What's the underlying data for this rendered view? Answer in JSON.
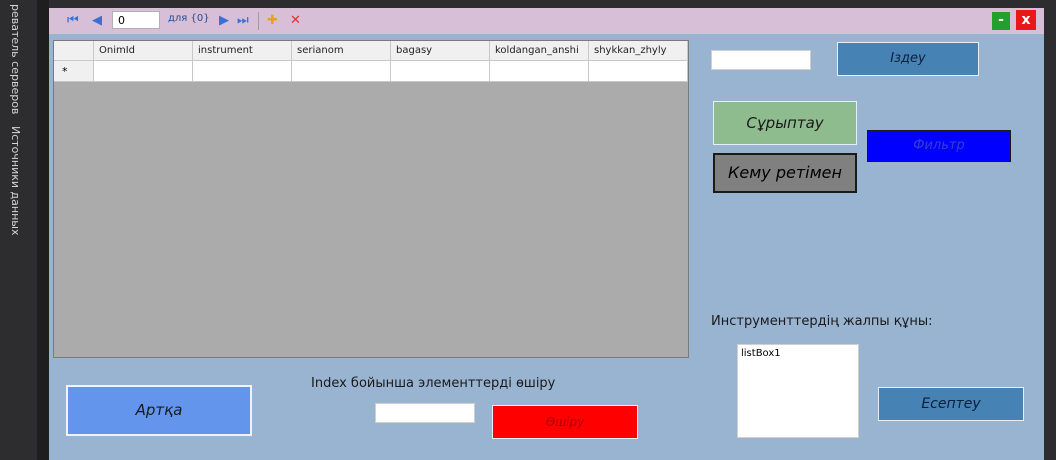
{
  "ide": {
    "server_explorer_tab": "реватель серверов",
    "data_sources_tab": "Источники данных"
  },
  "navigator": {
    "position_value": "0",
    "count_text": "для {0}"
  },
  "grid": {
    "columns": [
      "OnimId",
      "instrument",
      "serianom",
      "bagasy",
      "koldangan_anshi",
      "shykkan_zhyly"
    ],
    "new_row_marker": "*"
  },
  "search": {
    "button_label": "Іздеу",
    "input_value": ""
  },
  "sort": {
    "button_label": "Сұрыптау"
  },
  "filter": {
    "button_label": "Фильтр"
  },
  "descending": {
    "button_label": "Кему ретімен"
  },
  "total": {
    "label": "Инструменттердің жалпы құны:",
    "listbox_text": "listBox1",
    "calc_button_label": "Есептеу"
  },
  "delete": {
    "label": "Index бойынша элементтерді өшіру",
    "input_value": "",
    "button_label": "Өшіру"
  },
  "back": {
    "button_label": "Артқа"
  },
  "colors": {
    "form_bg": "#99b4d1",
    "toolbar_bg": "#d8bfd8",
    "search_btn": "#4682b4",
    "sort_btn": "#8fbc8f",
    "filter_btn": "#0000ff",
    "descending_btn": "#808080",
    "back_btn": "#6495ed",
    "delete_btn": "#ff0000",
    "calc_btn": "#4682b4"
  }
}
